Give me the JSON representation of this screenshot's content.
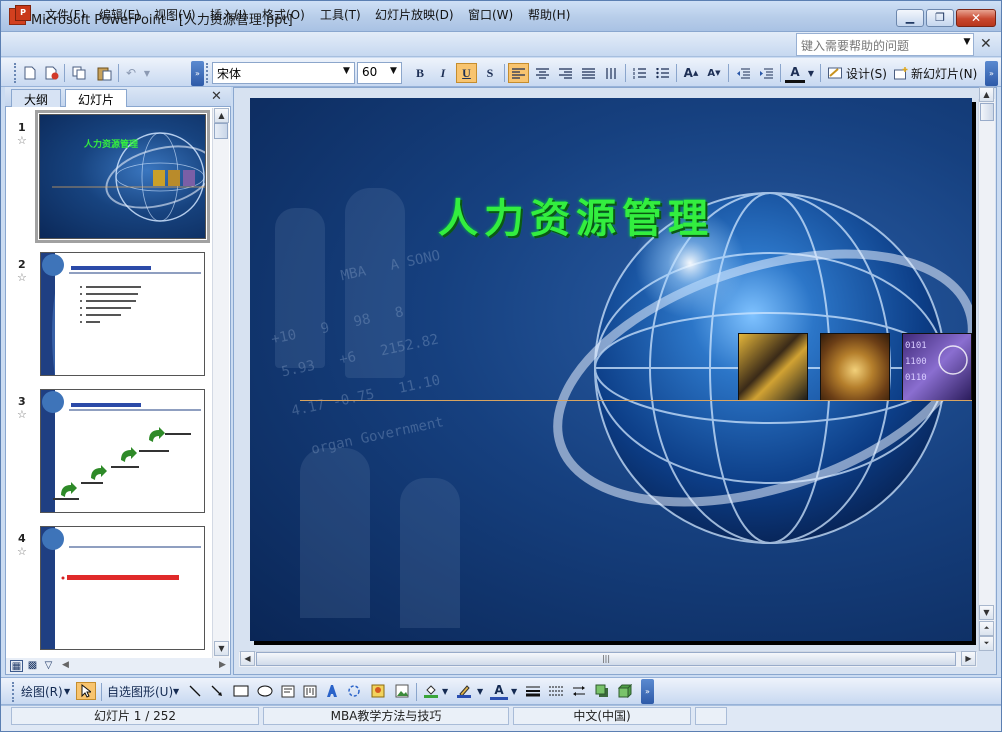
{
  "window": {
    "title": "Microsoft PowerPoint - [人力资源管理.ppt]",
    "app_icon_text": "P"
  },
  "menu": {
    "items": [
      "文件(F)",
      "编辑(E)",
      "视图(V)",
      "插入(I)",
      "格式(O)",
      "工具(T)",
      "幻灯片放映(D)",
      "窗口(W)",
      "帮助(H)"
    ],
    "help_placeholder": "键入需要帮助的问题"
  },
  "toolbar": {
    "font_name": "宋体",
    "font_size": "60",
    "bold": "B",
    "italic": "I",
    "underline": "U",
    "shadow": "S",
    "design_label": "设计(S)",
    "new_slide_label": "新幻灯片(N)"
  },
  "left_panel": {
    "tabs": [
      "大纲",
      "幻灯片"
    ],
    "active_tab": "幻灯片",
    "slides": [
      {
        "number": "1",
        "selected": true
      },
      {
        "number": "2",
        "selected": false
      },
      {
        "number": "3",
        "selected": false
      },
      {
        "number": "4",
        "selected": false
      }
    ]
  },
  "slide": {
    "title": "人力资源管理"
  },
  "drawing_toolbar": {
    "draw_label": "绘图(R)",
    "autoshapes_label": "自选图形(U)"
  },
  "status": {
    "slide_position": "幻灯片 1 / 252",
    "template": "MBA教学方法与技巧",
    "language": "中文(中国)"
  },
  "colors": {
    "title_green": "#33ee3f",
    "slide_bg": "#16407f",
    "accent_line": "#d8a460"
  }
}
